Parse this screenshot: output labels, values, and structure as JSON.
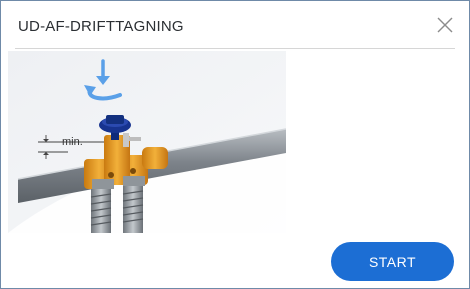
{
  "dialog": {
    "title": "UD-AF-DRIFTTAGNING",
    "close_icon": "close-icon",
    "illustration": {
      "measure_label": "min.",
      "icons": [
        "rotate-counterclockwise-icon",
        "arrow-down-icon"
      ]
    },
    "start_label": "START"
  },
  "colors": {
    "accent": "#1c6ed4",
    "border": "#6f8aa8",
    "valve_body": "#e89a1e",
    "handwheel": "#142f8a",
    "pipe": "#8a9096",
    "rotate_arrow": "#5aa0e8"
  }
}
